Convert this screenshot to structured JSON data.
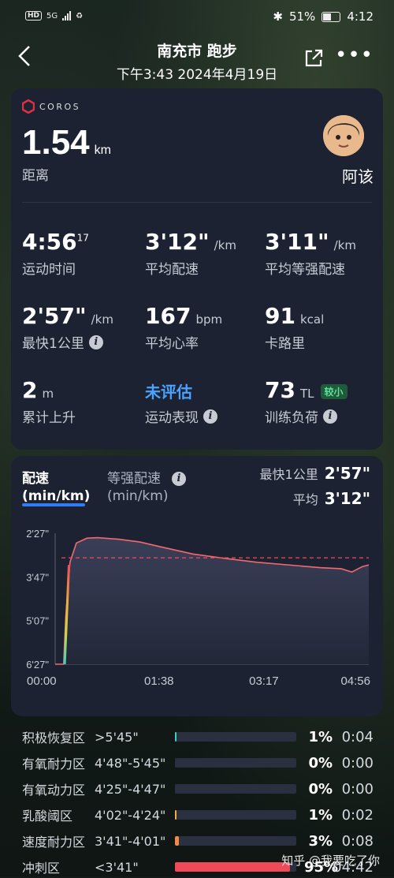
{
  "status": {
    "carrier": "HD",
    "signal": "5G",
    "battery": "51%",
    "time": "4:12"
  },
  "header": {
    "title": "南充市 跑步",
    "subtitle": "下午3:43 2024年4月19日"
  },
  "summary_card": {
    "brand": "COROS",
    "distance_value": "1.54",
    "distance_unit": "km",
    "distance_label": "距离",
    "user_name": "阿该",
    "stats": [
      {
        "value": "4:56",
        "sup": "17",
        "unit": "",
        "label": "运动时间",
        "info": false
      },
      {
        "value": "3'12\"",
        "sup": "",
        "unit": "/km",
        "label": "平均配速",
        "info": false
      },
      {
        "value": "3'11\"",
        "sup": "",
        "unit": "/km",
        "label": "平均等强配速",
        "info": false
      },
      {
        "value": "2'57\"",
        "sup": "",
        "unit": "/km",
        "label": "最快1公里",
        "info": true
      },
      {
        "value": "167",
        "sup": "",
        "unit": "bpm",
        "label": "平均心率",
        "info": false
      },
      {
        "value": "91",
        "sup": "",
        "unit": "kcal",
        "label": "卡路里",
        "info": false
      },
      {
        "value": "2",
        "sup": "",
        "unit": "m",
        "label": "累计上升",
        "info": false
      },
      {
        "value": "未评估",
        "sup": "",
        "unit": "",
        "label": "运动表现",
        "info": true
      },
      {
        "value": "73",
        "sup": "",
        "unit": "TL",
        "badge": "较小",
        "label": "训练负荷",
        "info": true
      }
    ]
  },
  "chart_section": {
    "tab_pace": "配速",
    "tab_pace_unit": "(min/km)",
    "tab_grade": "等强配速",
    "tab_grade_unit": "(min/km)",
    "fastest_label": "最快1公里",
    "fastest_value": "2'57\"",
    "avg_label": "平均",
    "avg_value": "3'12\""
  },
  "chart_data": {
    "type": "area",
    "title": "",
    "y_ticks": [
      "2'27\"",
      "3'47\"",
      "5'07\"",
      "6'27\""
    ],
    "x_ticks": [
      "00:00",
      "01:38",
      "03:17",
      "04:56"
    ],
    "ylim_seconds": [
      147,
      387
    ],
    "avg_pace_seconds": 192,
    "x_seconds": [
      0,
      8,
      10,
      14,
      20,
      30,
      40,
      60,
      80,
      100,
      130,
      160,
      190,
      220,
      250,
      270,
      280,
      290,
      296
    ],
    "pace_seconds": [
      387,
      387,
      300,
      200,
      165,
      156,
      155,
      158,
      163,
      172,
      185,
      193,
      200,
      205,
      210,
      212,
      218,
      208,
      205
    ]
  },
  "zones": [
    {
      "name": "积极恢复区",
      "range": ">5'45\"",
      "pct_value": 0.01,
      "pct": "1%",
      "time": "0:04",
      "color": "#3ad1c2"
    },
    {
      "name": "有氧耐力区",
      "range": "4'48\"-5'45\"",
      "pct_value": 0,
      "pct": "0%",
      "time": "0:00",
      "color": "#4ad07a"
    },
    {
      "name": "有氧动力区",
      "range": "4'25\"-4'47\"",
      "pct_value": 0,
      "pct": "0%",
      "time": "0:00",
      "color": "#c8d94a"
    },
    {
      "name": "乳酸阈区",
      "range": "4'02\"-4'24\"",
      "pct_value": 0.01,
      "pct": "1%",
      "time": "0:02",
      "color": "#f0b040"
    },
    {
      "name": "速度耐力区",
      "range": "3'41\"-4'01\"",
      "pct_value": 0.03,
      "pct": "3%",
      "time": "0:08",
      "color": "#f08a4a"
    },
    {
      "name": "冲刺区",
      "range": "<3'41\"",
      "pct_value": 0.95,
      "pct": "95%",
      "time": "04:42",
      "color": "#f04a58"
    }
  ],
  "watermark": "知乎 @我要吃了你"
}
